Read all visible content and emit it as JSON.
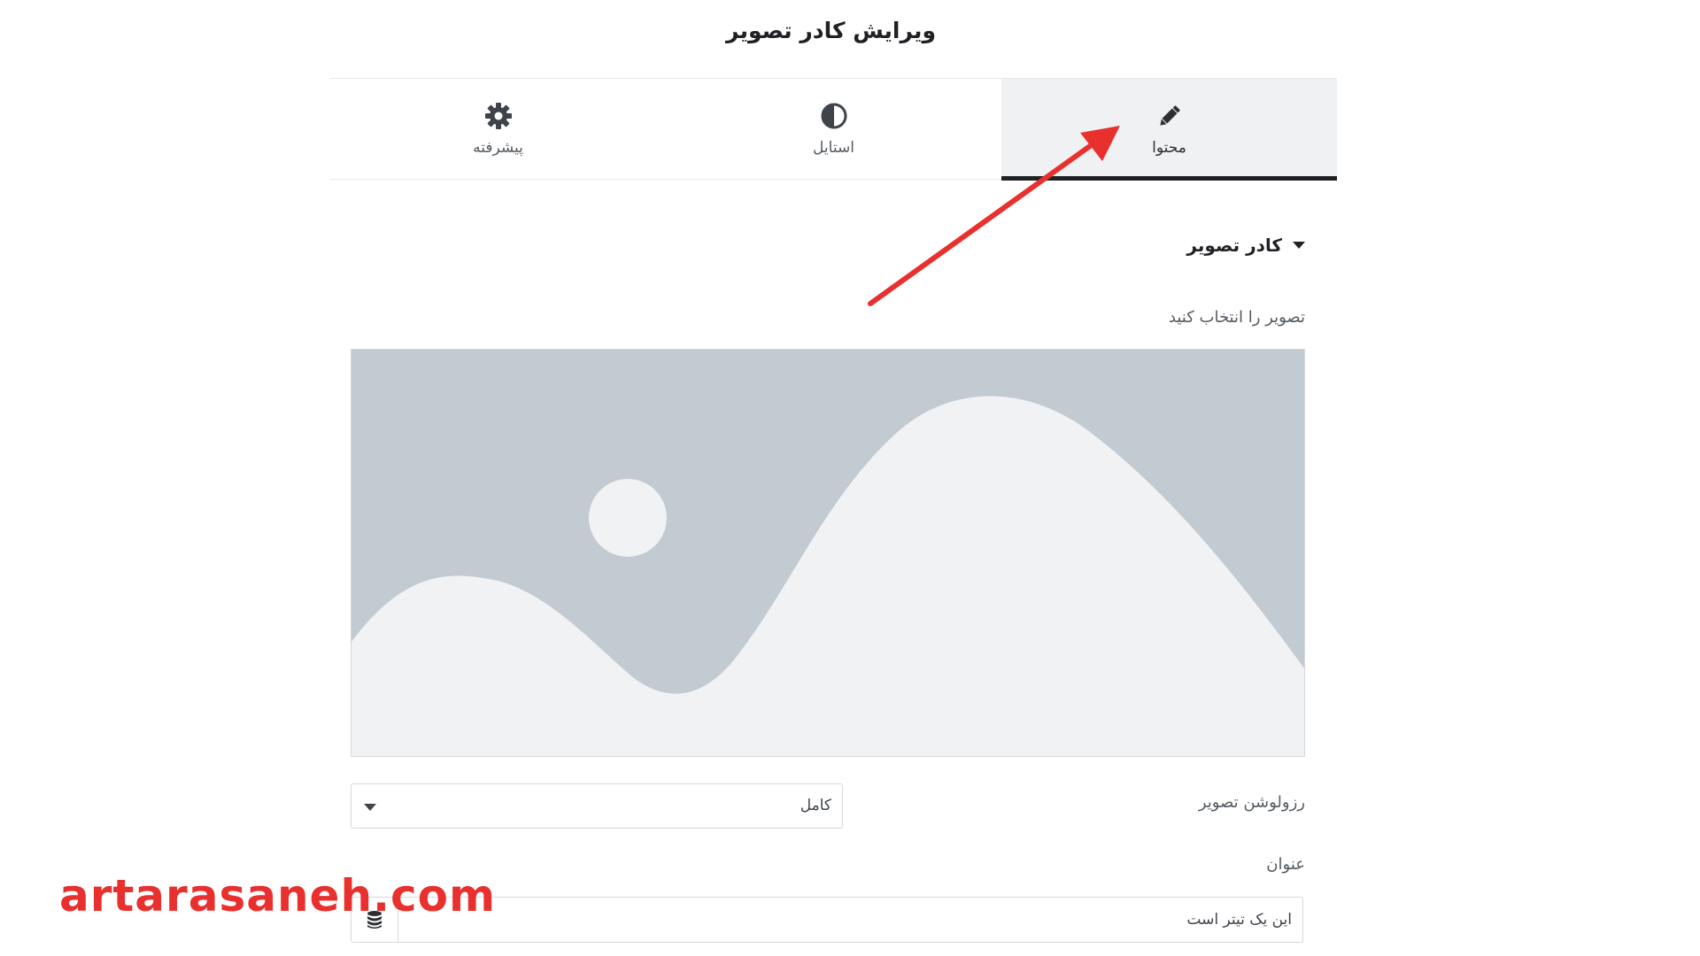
{
  "header": {
    "title": "ویرایش کادر تصویر"
  },
  "tabs": [
    {
      "label": "محتوا",
      "icon": "pencil-icon",
      "active": true
    },
    {
      "label": "استایل",
      "icon": "contrast-icon",
      "active": false
    },
    {
      "label": "پیشرفته",
      "icon": "gear-icon",
      "active": false
    }
  ],
  "section": {
    "title": "کادر تصویر",
    "choose_image_label": "تصویر را انتخاب کنید"
  },
  "resolution": {
    "label": "رزولوشن تصویر",
    "value": "کامل"
  },
  "title_field": {
    "label": "عنوان",
    "value": "این یک تیتر است"
  },
  "watermark": "artarasaneh.com",
  "colors": {
    "accent_arrow": "#e8302e",
    "placeholder_bg": "#c2cad2",
    "placeholder_fg": "#f1f2f3"
  }
}
